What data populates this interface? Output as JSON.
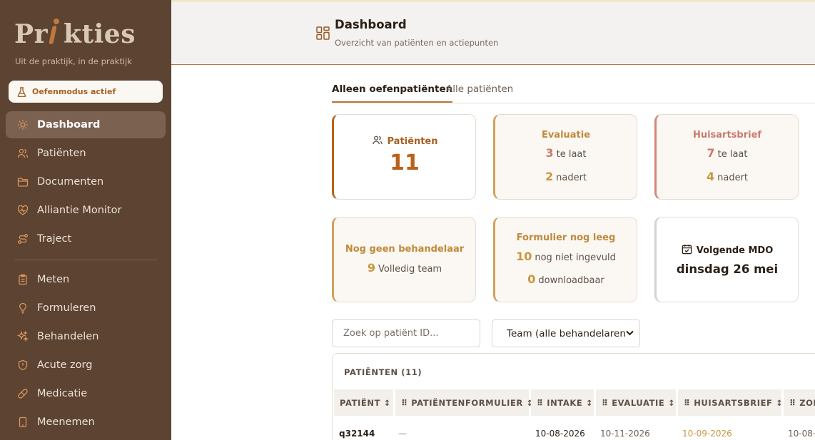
{
  "app": {
    "logo_text_a": "Pr",
    "logo_text_b": "kties",
    "tagline": "Uit de praktijk, in de praktijk",
    "mode_badge": "Oefenmodus actief"
  },
  "sidebar": {
    "items": [
      {
        "label": "Dashboard",
        "icon": "sun-icon",
        "active": true
      },
      {
        "label": "Patiënten",
        "icon": "users-icon"
      },
      {
        "label": "Documenten",
        "icon": "folder-icon"
      },
      {
        "label": "Alliantie Monitor",
        "icon": "heart-pulse-icon"
      },
      {
        "label": "Traject",
        "icon": "route-icon"
      },
      {
        "label": "Meten",
        "icon": "clipboard-icon"
      },
      {
        "label": "Formuleren",
        "icon": "lightbulb-icon"
      },
      {
        "label": "Behandelen",
        "icon": "sparkles-icon"
      },
      {
        "label": "Acute zorg",
        "icon": "shield-alert-icon"
      },
      {
        "label": "Medicatie",
        "icon": "pill-icon"
      },
      {
        "label": "Meenemen",
        "icon": "phone-icon"
      }
    ]
  },
  "header": {
    "title": "Dashboard",
    "subtitle": "Overzicht van patiënten en actiepunten"
  },
  "tabs": [
    {
      "label": "Alleen oefenpatiënten",
      "active": true
    },
    {
      "label": "Alle patiënten",
      "active": false
    }
  ],
  "cards": {
    "patients": {
      "title": "Patiënten",
      "value": "11"
    },
    "evaluatie": {
      "title": "Evaluatie",
      "late_num": "3",
      "late_label": "te laat",
      "near_num": "2",
      "near_label": "nadert"
    },
    "huisartsbrief": {
      "title": "Huisartsbrief",
      "late_num": "7",
      "late_label": "te laat",
      "near_num": "4",
      "near_label": "nadert"
    },
    "behandelaar": {
      "title": "Nog geen behandelaar",
      "num": "9",
      "label": "Volledig team"
    },
    "formulier": {
      "title": "Formulier nog leeg",
      "empty_num": "10",
      "empty_label": "nog niet ingevuld",
      "dl_num": "0",
      "dl_label": "downloadbaar"
    },
    "mdo": {
      "title": "Volgende MDO",
      "date": "dinsdag 26 mei"
    }
  },
  "filters": {
    "search_placeholder": "Zoek op patiënt ID...",
    "team_select": "Team (alle behandelaren"
  },
  "table": {
    "title": "PATIËNTEN (11)",
    "columns": [
      "PATIËNT ↕",
      "⠿ PATIËNTENFORMULIER ↕",
      "⠿ INTAKE ↕",
      "⠿ EVALUATIE ↕",
      "⠿ HUISARTSBRIEF ↕",
      "⠿ ZORG"
    ],
    "rows": [
      {
        "patient": "q32144",
        "formulier": "—",
        "intake": "10-08-2026",
        "evaluatie": "10-11-2026",
        "huisartsbrief": "10-09-2026",
        "zorg": "10-08-"
      }
    ]
  },
  "colors": {
    "sidebar_bg": "#5c4332",
    "accent_brown": "#b8621c",
    "accent_gold": "#c9963e",
    "accent_rose": "#c97a6c"
  }
}
